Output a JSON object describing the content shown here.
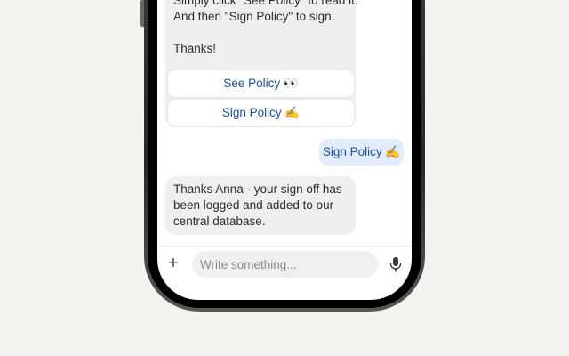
{
  "chat": {
    "bot_message_1": {
      "lines": [
        "Simply click \"See Policy\" to read it.",
        "And then \"Sign Policy\" to sign.",
        "",
        "Thanks!"
      ]
    },
    "actions": {
      "see_policy_label": "See Policy 👀",
      "sign_policy_label": "Sign Policy ✍️"
    },
    "user_message": "Sign Policy ✍️",
    "bot_message_2": {
      "lines": [
        "Thanks Anna - your sign off has",
        "been logged and added to our",
        "central database."
      ]
    }
  },
  "composer": {
    "add_icon": "plus-icon",
    "placeholder": "Write something...",
    "value": "",
    "mic_icon": "microphone-icon"
  },
  "colors": {
    "background": "#f3f3f1",
    "bot_bubble": "#efefef",
    "user_bubble": "#e3ecfd",
    "link_blue": "#1a4fa8"
  }
}
